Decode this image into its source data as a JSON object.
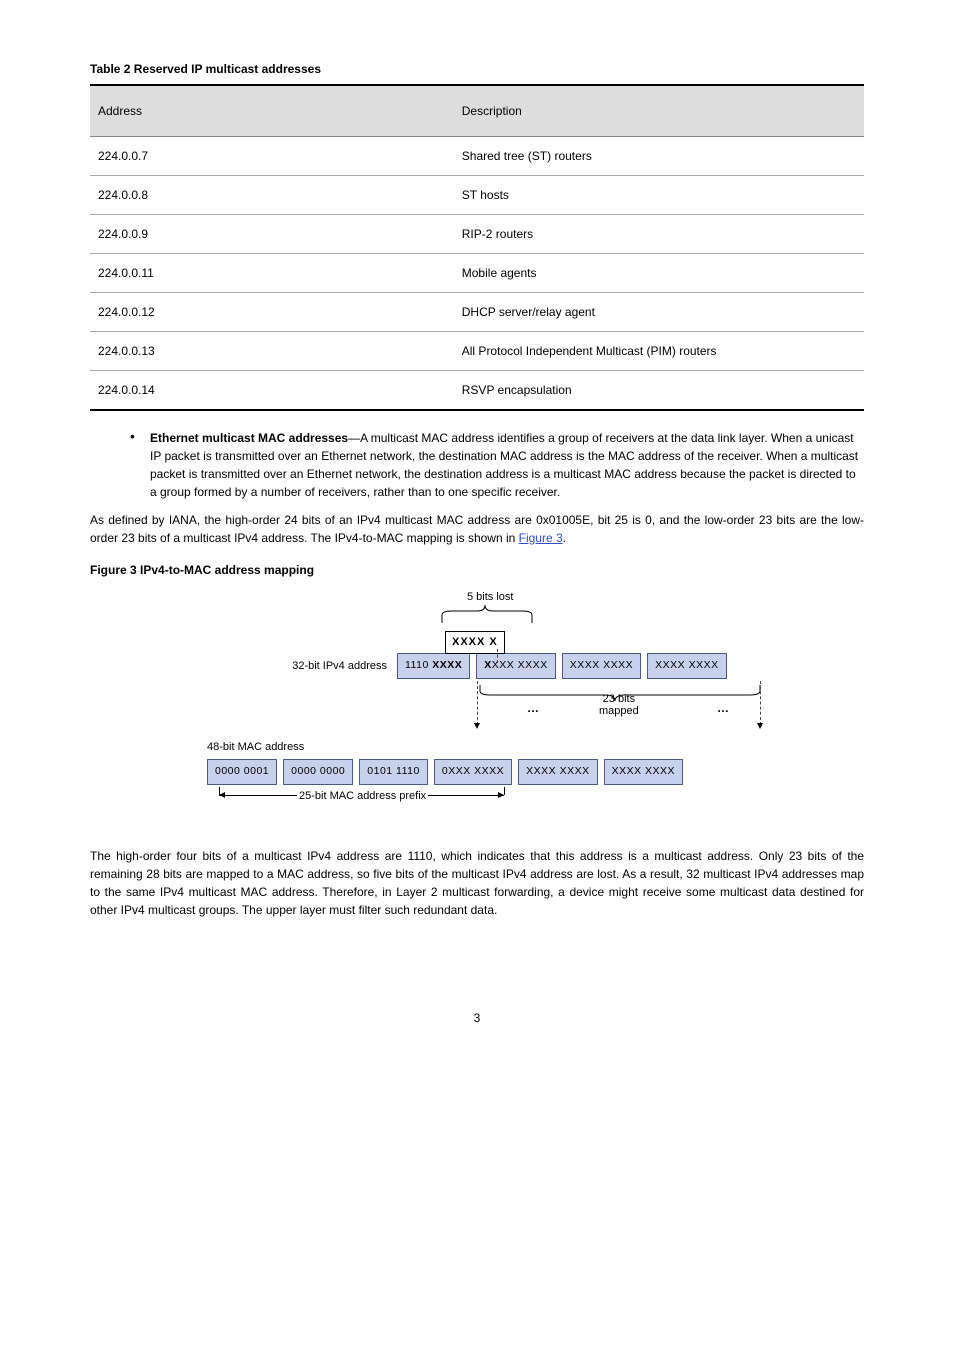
{
  "table": {
    "caption": "Table 2 Reserved IP multicast addresses",
    "header": {
      "col1": "Address",
      "col2": "Description"
    },
    "rows": [
      {
        "addr": "224.0.0.7",
        "desc": "Shared tree (ST) routers"
      },
      {
        "addr": "224.0.0.8",
        "desc": "ST hosts"
      },
      {
        "addr": "224.0.0.9",
        "desc": "RIP-2 routers"
      },
      {
        "addr": "224.0.0.11",
        "desc": "Mobile agents"
      },
      {
        "addr": "224.0.0.12",
        "desc": "DHCP server/relay agent"
      },
      {
        "addr": "224.0.0.13",
        "desc": "All Protocol Independent Multicast (PIM) routers"
      },
      {
        "addr": "224.0.0.14",
        "desc": "RSVP encapsulation"
      }
    ]
  },
  "bullet": {
    "heading": "Ethernet multicast MAC addresses",
    "body": "—A multicast MAC address identifies a group of receivers at the data link layer. When a unicast IP packet is transmitted over an Ethernet network, the destination MAC address is the MAC address of the receiver. When a multicast packet is transmitted over an Ethernet network, the destination address is a multicast MAC address because the packet is directed to a group formed by a number of receivers, rather than to one specific receiver."
  },
  "para1": "As defined by IANA, the high-order 24 bits of an IPv4 multicast MAC address are 0x01005E, bit 25 is 0, and the low-order 23 bits are the low-order 23 bits of a multicast IPv4 address. The IPv4-to-MAC mapping is shown in ",
  "linkText": "Figure 3",
  "para1_tail": ".",
  "figcaption": "Figure 3 IPv4-to-MAC address mapping",
  "fig": {
    "fivebits": "5 bits lost",
    "xxxx_x": "XXXX X",
    "row1_label": "32-bit IPv4 address",
    "row1_oct1_pre": "1110 ",
    "row1_oct1_b": "XXXX",
    "row1_oct2_b": "X",
    "row1_oct2_post": "XXX XXXX",
    "row1_oct3": "XXXX XXXX",
    "row1_oct4": "XXXX XXXX",
    "dots": "…",
    "mapped": "23 bits\nmapped",
    "row2_label": "48-bit MAC address",
    "row3_o1": "0000 0001",
    "row3_o2": "0000 0000",
    "row3_o3": "0101 1110",
    "row3_o4": "0XXX XXXX",
    "row3_o5": "XXXX XXXX",
    "row3_o6": "XXXX XXXX",
    "prefix": "25-bit MAC address prefix"
  },
  "para2": "The high-order four bits of a multicast IPv4 address are 1110, which indicates that this address is a multicast address. Only 23 bits of the remaining 28 bits are mapped to a MAC address, so five bits of the multicast IPv4 address are lost. As a result, 32 multicast IPv4 addresses map to the same IPv4 multicast MAC address. Therefore, in Layer 2 multicast forwarding, a device might receive some multicast data destined for other IPv4 multicast groups. The upper layer must filter such redundant data.",
  "pageNumber": "3"
}
